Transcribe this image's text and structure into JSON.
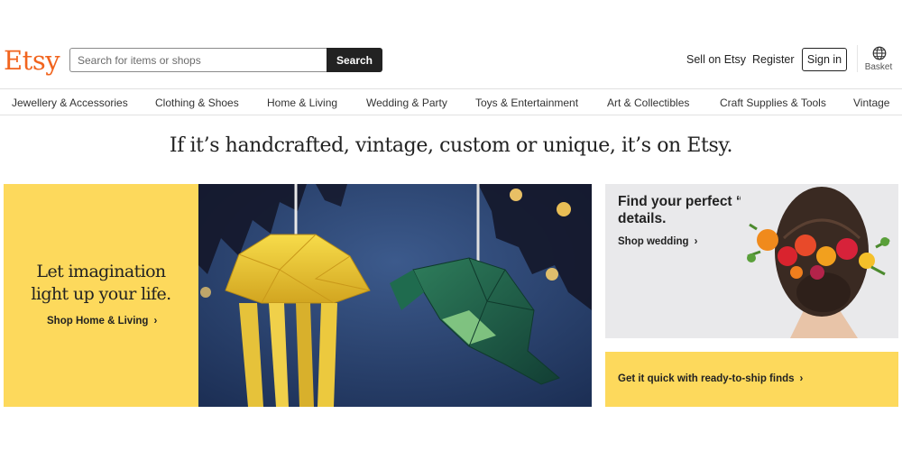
{
  "header": {
    "logo": "Etsy",
    "search": {
      "placeholder": "Search for items or shops",
      "value": "",
      "button_label": "Search"
    },
    "sell_link": "Sell on Etsy",
    "register_link": "Register",
    "signin_label": "Sign in",
    "basket_label": "Basket",
    "basket_icon": "globe-basket-icon"
  },
  "categories": [
    "Jewellery & Accessories",
    "Clothing & Shoes",
    "Home & Living",
    "Wedding & Party",
    "Toys & Entertainment",
    "Art & Collectibles",
    "Craft Supplies & Tools",
    "Vintage"
  ],
  "tagline": "If it’s handcrafted, vintage, custom or unique, it’s on Etsy.",
  "hero": {
    "heading_line1": "Let imagination",
    "heading_line2": "light up your life.",
    "link": "Shop Home & Living",
    "chevron": "›"
  },
  "wedding_card": {
    "title": "Find your perfect “I do” details.",
    "link": "Shop wedding",
    "chevron": "›"
  },
  "ship_card": {
    "link": "Get it quick with ready-to-ship finds",
    "chevron": "›"
  },
  "colors": {
    "brand": "#f1641e",
    "promo_yellow": "#fdd95c",
    "dark": "#222222",
    "card_gray": "#e9e9eb"
  }
}
